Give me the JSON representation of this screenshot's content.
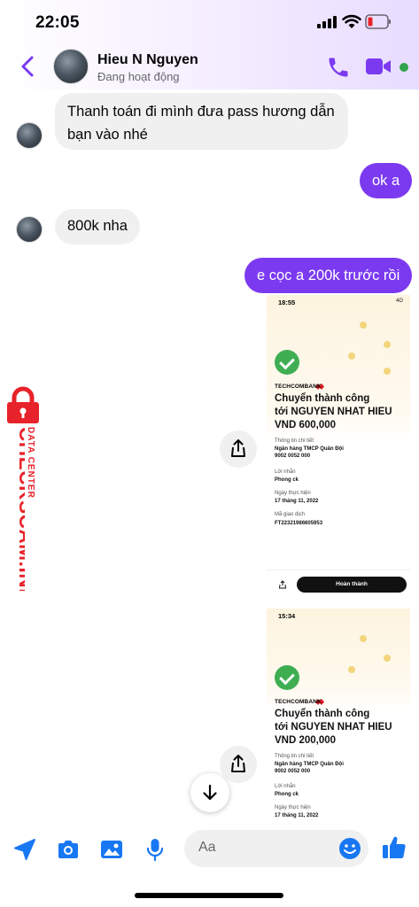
{
  "status_bar": {
    "time": "22:05"
  },
  "header": {
    "contact_name": "Hieu N Nguyen",
    "presence": "Đang hoạt động",
    "colors": {
      "accent": "#7b3af0",
      "online": "#31a24c"
    }
  },
  "messages": [
    {
      "side": "in",
      "text_lines": [
        "Thanh toán đi mình đưa pass hương dẫn",
        "bạn vào nhé"
      ]
    },
    {
      "side": "out",
      "text": "ok a"
    },
    {
      "side": "in",
      "text": "800k nha"
    },
    {
      "side": "out",
      "text": "e cọc a 200k trước rồi"
    }
  ],
  "receipts": [
    {
      "status_time": "18:55",
      "network": "4G",
      "bank": "TECHCOMBANK",
      "title_lines": [
        "Chuyển thành công",
        "tới NGUYEN NHAT HIEU",
        "VND 600,000"
      ],
      "details_header": "Thông tin chi tiết",
      "bank_name": "Ngân hàng TMCP Quân Đội",
      "account": "9002 0052 000",
      "message_label": "Lời nhắn",
      "message": "Phong ck",
      "date_label": "Ngày thực hiện",
      "date": "17 tháng 11, 2022",
      "txn_label": "Mã giao dịch",
      "txn": "FT22321986605953",
      "done_button": "Hoàn thành"
    },
    {
      "status_time": "15:34",
      "bank": "TECHCOMBANK",
      "title_lines": [
        "Chuyển thành công",
        "tới NGUYEN NHAT HIEU",
        "VND 200,000"
      ],
      "details_header": "Thông tin chi tiết",
      "bank_name": "Ngân hàng TMCP Quân Đội",
      "account": "9002 0052 000",
      "message_label": "Lời nhắn",
      "message": "Phong ck",
      "date_label": "Ngày thực hiện",
      "date": "17 tháng 11, 2022"
    }
  ],
  "watermark": {
    "main": "CHECKSCAM.INFO",
    "sub": "DATA CENTER",
    "color": "#e8222a"
  },
  "composer": {
    "placeholder": "Aa",
    "icons": [
      "location-icon",
      "camera-icon",
      "gallery-icon",
      "microphone-icon",
      "emoji-icon",
      "thumbs-up-icon"
    ],
    "icon_color": "#1877f2"
  }
}
